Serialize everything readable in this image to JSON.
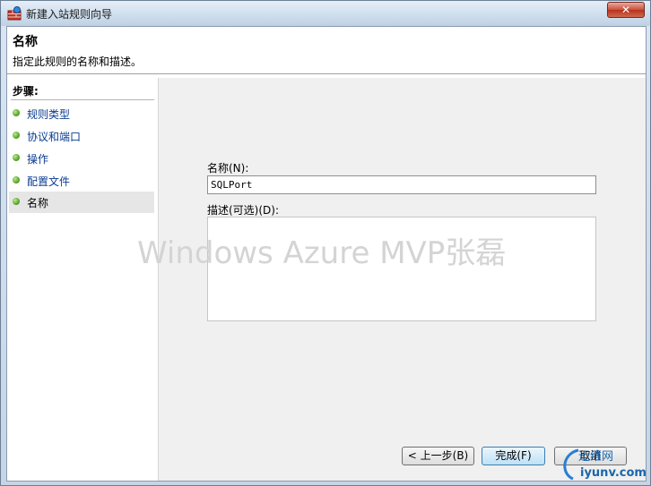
{
  "window": {
    "title": "新建入站规则向导",
    "close_label": "✕"
  },
  "header": {
    "title": "名称",
    "subtitle": "指定此规则的名称和描述。"
  },
  "steps": {
    "title": "步骤:",
    "items": [
      {
        "label": "规则类型"
      },
      {
        "label": "协议和端口"
      },
      {
        "label": "操作"
      },
      {
        "label": "配置文件"
      },
      {
        "label": "名称",
        "active": true
      }
    ]
  },
  "form": {
    "name_label": "名称(N):",
    "name_value": "SQLPort",
    "desc_label": "描述(可选)(D):",
    "desc_value": ""
  },
  "buttons": {
    "back": "< 上一步(B)",
    "finish": "完成(F)",
    "cancel": "取消"
  },
  "watermark": "Windows Azure MVP张磊",
  "site_logo": {
    "line1": "运维网",
    "line2": "iyunv.com"
  },
  "colors": {
    "step_link": "#0b3d91",
    "step_dot": "#4c9a1e"
  }
}
